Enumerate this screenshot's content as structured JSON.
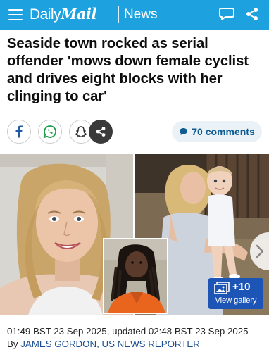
{
  "header": {
    "brand_thin": "Daily",
    "brand_bold": "Mail",
    "section": "News",
    "menu_icon": "hamburger-icon",
    "comment_icon": "speech-bubble-icon",
    "share_icon": "share-icon"
  },
  "article": {
    "headline": "Seaside town rocked as serial offender 'mows down female cyclist and drives eight blocks with her clinging to car'",
    "timestamp": "01:49 BST 23 Sep 2025, updated 02:48 BST 23 Sep 2025",
    "byline_prefix": "By",
    "author": "JAMES GORDON, US NEWS REPORTER"
  },
  "share_bar": {
    "buttons": [
      "facebook-icon",
      "whatsapp-icon",
      "snapchat-icon",
      "share-icon"
    ],
    "comments": "70 comments"
  },
  "gallery": {
    "count": "+10",
    "label": "View gallery"
  },
  "colors": {
    "header_bg": "#1da2df",
    "comments_text": "#0d5b91",
    "gallery_bg": "#1c55b6",
    "author_link": "#1a4e8f"
  }
}
